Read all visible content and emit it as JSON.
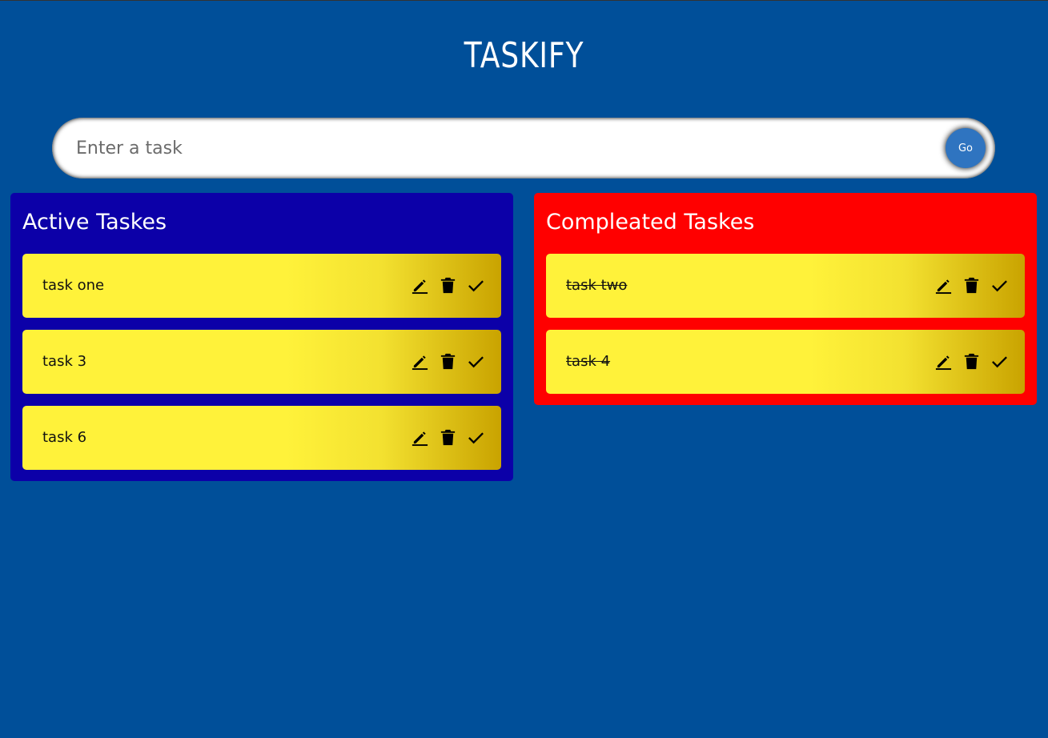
{
  "app": {
    "title": "TASKIFY"
  },
  "input": {
    "placeholder": "Enter a task",
    "value": "",
    "submit_label": "Go"
  },
  "active": {
    "heading": "Active Taskes",
    "tasks": [
      {
        "text": "task one",
        "done": false
      },
      {
        "text": "task 3",
        "done": false
      },
      {
        "text": "task 6",
        "done": false
      }
    ]
  },
  "completed": {
    "heading": "Compleated Taskes",
    "tasks": [
      {
        "text": "task two",
        "done": true
      },
      {
        "text": "task 4",
        "done": true
      }
    ]
  },
  "icons": {
    "edit": "pencil-icon",
    "delete": "trash-icon",
    "complete": "check-icon"
  },
  "colors": {
    "background": "#004f99",
    "active_panel": "#0c00a8",
    "completed_panel": "#ff0000",
    "card": "#fff23a",
    "button": "#2f74c0"
  }
}
